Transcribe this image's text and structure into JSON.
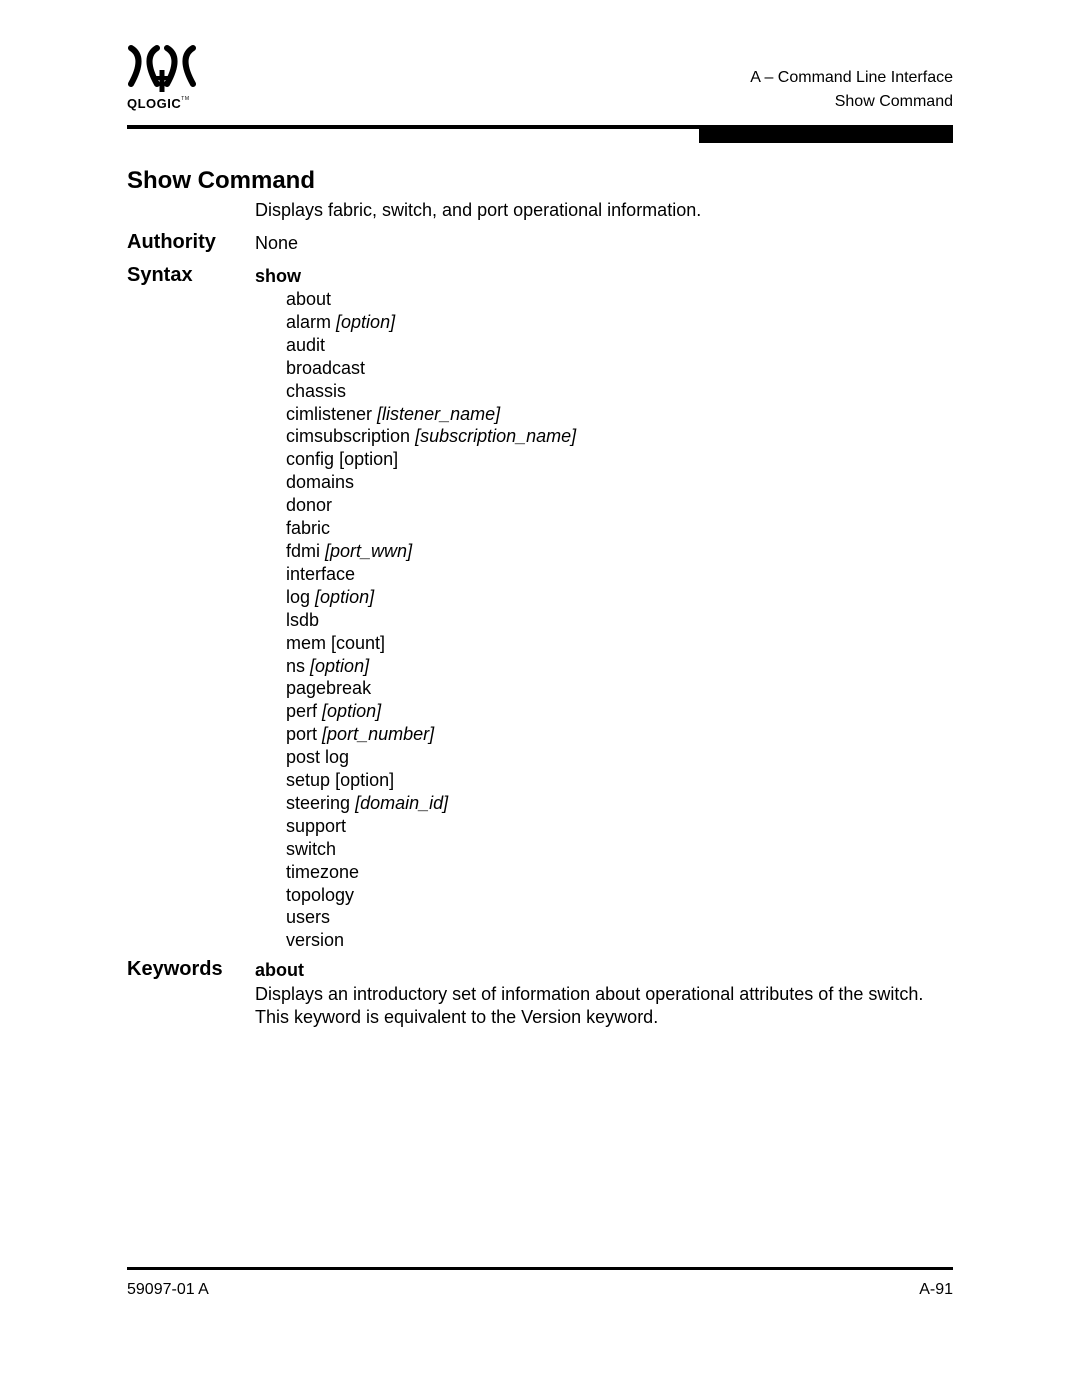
{
  "header": {
    "logo_text": "QLOGIC",
    "logo_tm": "TM",
    "running_head_line1": "A – Command Line Interface",
    "running_head_line2": "Show Command"
  },
  "section": {
    "title": "Show Command",
    "description": "Displays fabric, switch, and port operational information.",
    "authority_label": "Authority",
    "authority_value": "None",
    "syntax_label": "Syntax",
    "syntax_command": "show",
    "options": [
      {
        "name": "about",
        "arg": "",
        "arg_italic": false
      },
      {
        "name": "alarm",
        "arg": "[option]",
        "arg_italic": true
      },
      {
        "name": "audit",
        "arg": "",
        "arg_italic": false
      },
      {
        "name": "broadcast",
        "arg": "",
        "arg_italic": false
      },
      {
        "name": "chassis",
        "arg": "",
        "arg_italic": false
      },
      {
        "name": "cimlistener",
        "arg": "[listener_name]",
        "arg_italic": true
      },
      {
        "name": "cimsubscription",
        "arg": "[subscription_name]",
        "arg_italic": true
      },
      {
        "name": "config",
        "arg": "[option]",
        "arg_italic": false
      },
      {
        "name": "domains",
        "arg": "",
        "arg_italic": false
      },
      {
        "name": "donor",
        "arg": "",
        "arg_italic": false
      },
      {
        "name": "fabric",
        "arg": "",
        "arg_italic": false
      },
      {
        "name": "fdmi",
        "arg": "[port_wwn]",
        "arg_italic": true
      },
      {
        "name": "interface",
        "arg": "",
        "arg_italic": false
      },
      {
        "name": "log",
        "arg": "[option]",
        "arg_italic": true
      },
      {
        "name": "lsdb",
        "arg": "",
        "arg_italic": false
      },
      {
        "name": "mem",
        "arg": "[count]",
        "arg_italic": false
      },
      {
        "name": "ns",
        "arg": "[option]",
        "arg_italic": true
      },
      {
        "name": "pagebreak",
        "arg": "",
        "arg_italic": false
      },
      {
        "name": "perf",
        "arg": "[option]",
        "arg_italic": true
      },
      {
        "name": "port",
        "arg": "[port_number]",
        "arg_italic": true
      },
      {
        "name": "post log",
        "arg": "",
        "arg_italic": false
      },
      {
        "name": "setup",
        "arg": "[option]",
        "arg_italic": false
      },
      {
        "name": "steering",
        "arg": "[domain_id]",
        "arg_italic": true
      },
      {
        "name": "support",
        "arg": "",
        "arg_italic": false
      },
      {
        "name": "switch",
        "arg": "",
        "arg_italic": false
      },
      {
        "name": "timezone",
        "arg": "",
        "arg_italic": false
      },
      {
        "name": "topology",
        "arg": "",
        "arg_italic": false
      },
      {
        "name": "users",
        "arg": "",
        "arg_italic": false
      },
      {
        "name": "version",
        "arg": "",
        "arg_italic": false
      }
    ],
    "keywords_label": "Keywords",
    "keyword_name": "about",
    "keyword_description": "Displays an introductory set of information about operational attributes of the switch. This keyword is equivalent to the Version keyword."
  },
  "footer": {
    "doc_number": "59097-01 A",
    "page_number": "A-91"
  }
}
